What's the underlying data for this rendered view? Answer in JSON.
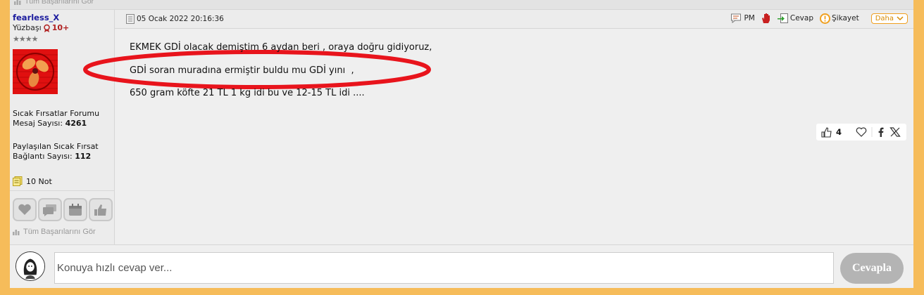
{
  "top": {
    "achievements_link": "Tüm Başarılarını Gör"
  },
  "user": {
    "name": "fearless_X",
    "rank": "Yüzbaşı",
    "level": "10+",
    "stars": "★★★★",
    "forum": "Sıcak Fırsatlar Forumu",
    "posts_label": "Mesaj Sayısı: ",
    "posts": "4261",
    "shared_label1": "Paylaşılan Sıcak Fırsat",
    "shared_label2": "Bağlantı Sayısı: ",
    "shared": "112",
    "notes": "10 Not",
    "achievements_link": "Tüm Başarılarını Gör",
    "badges": [
      "heart-badge-icon",
      "chat-badge-icon",
      "calendar-badge-icon",
      "thumbs-up-badge-icon"
    ]
  },
  "post": {
    "date": "05 Ocak 2022 20:16:36",
    "actions": {
      "pm": "PM",
      "reply": "Cevap",
      "report": "Şikayet",
      "more": "Daha"
    },
    "lines": [
      "EKMEK GDİ olacak demiştim 6 aydan beri , oraya doğru gidiyoruz,",
      "GDİ soran muradına ermiştir buldu mu GDİ yını  ,",
      "650 gram köfte 21 TL 1 kg idi bu ve 12-15 TL idi ...."
    ],
    "likes": "4",
    "highlight_color": "#e8141c"
  },
  "quick_reply": {
    "placeholder": "Konuya hızlı cevap ver...",
    "button": "Cevapla"
  },
  "colors": {
    "background": "#f6bc5a",
    "accent": "#f0a020",
    "username": "#1c1c9e"
  }
}
